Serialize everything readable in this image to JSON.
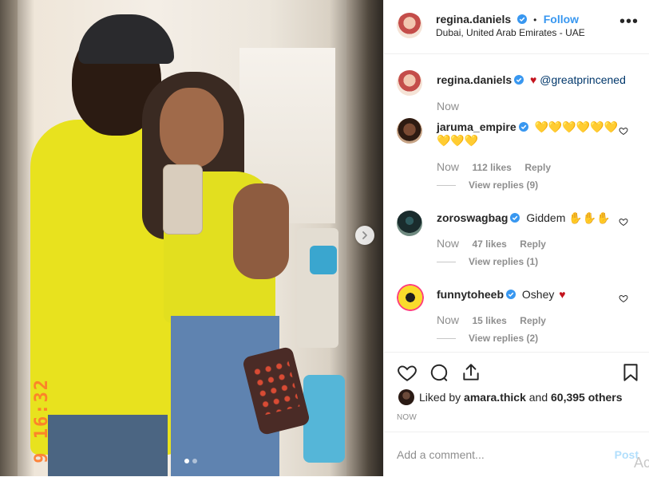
{
  "photo": {
    "timestamp_stamp": "9 16:32",
    "carousel_dots": [
      true,
      false
    ]
  },
  "header": {
    "username": "regina.daniels",
    "separator": "•",
    "follow_label": "Follow",
    "location": "Dubai, United Arab Emirates - UAE",
    "more_label": "•••"
  },
  "caption": {
    "username": "regina.daniels",
    "mention": "@greatprincened",
    "time": "Now"
  },
  "comments": [
    {
      "username": "jaruma_empire",
      "text_line1": "💛💛💛💛💛💛",
      "text_line2": "💛💛💛",
      "time": "Now",
      "likes": "112 likes",
      "reply": "Reply",
      "view_replies": "View replies (9)"
    },
    {
      "username": "zoroswagbag",
      "text": "Giddem ✋✋✋",
      "time": "Now",
      "likes": "47 likes",
      "reply": "Reply",
      "view_replies": "View replies (1)"
    },
    {
      "username": "funnytoheeb",
      "text": "Oshey",
      "time": "Now",
      "likes": "15 likes",
      "reply": "Reply",
      "view_replies": "View replies (2)"
    }
  ],
  "likes": {
    "prefix": "Liked by",
    "user": "amara.thick",
    "and": "and",
    "count": "60,395 others"
  },
  "post_time": "NOW",
  "add_comment": {
    "placeholder": "Add a comment...",
    "post_label": "Post"
  },
  "watermark": "Act",
  "colors": {
    "accent": "#3897f0",
    "heart_red": "#c4141e",
    "muted": "#8e8e8e",
    "stamp_orange": "#ff7a2b"
  }
}
